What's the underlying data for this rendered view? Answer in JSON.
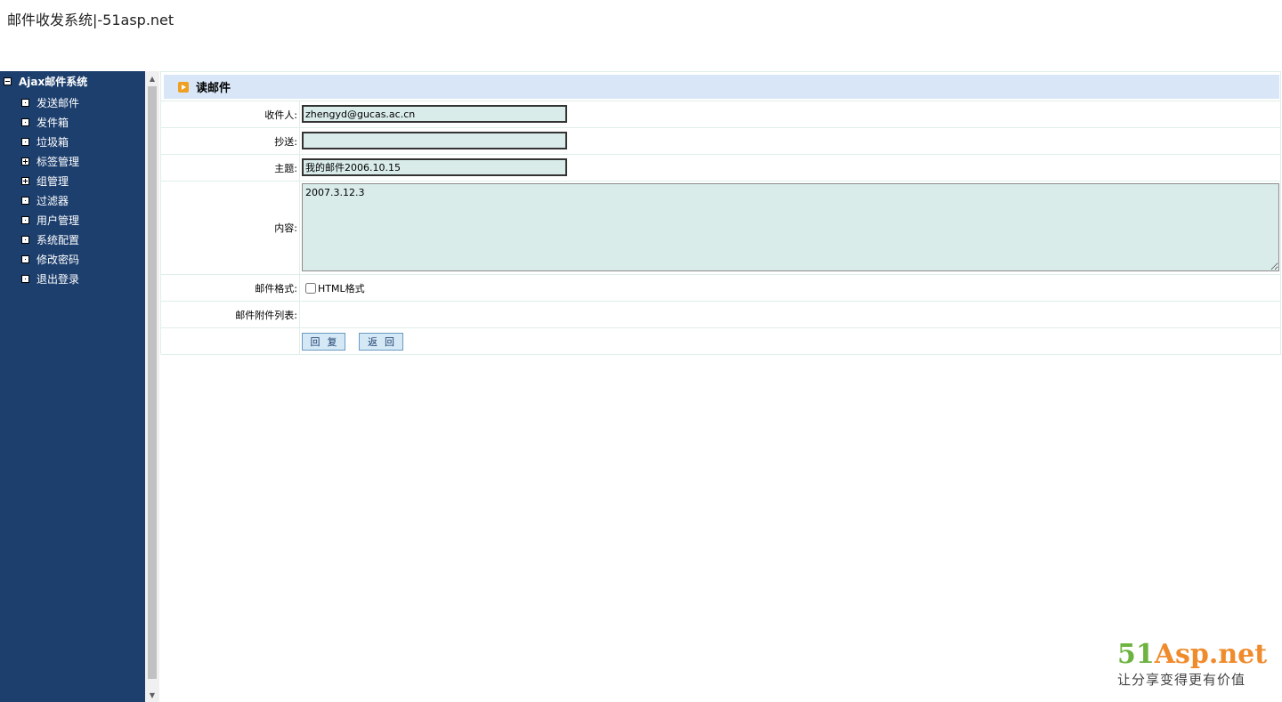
{
  "page": {
    "title": "邮件收发系统|-51asp.net"
  },
  "sidebar": {
    "root_label": "Ajax邮件系统",
    "items": [
      {
        "label": "发送邮件",
        "box": "dot"
      },
      {
        "label": "发件箱",
        "box": "dot"
      },
      {
        "label": "垃圾箱",
        "box": "dot"
      },
      {
        "label": "标签管理",
        "box": "plus"
      },
      {
        "label": "组管理",
        "box": "plus"
      },
      {
        "label": "过滤器",
        "box": "dot"
      },
      {
        "label": "用户管理",
        "box": "dot"
      },
      {
        "label": "系统配置",
        "box": "dot"
      },
      {
        "label": "修改密码",
        "box": "dot"
      },
      {
        "label": "退出登录",
        "box": "dot"
      }
    ]
  },
  "panel": {
    "title": "读邮件",
    "icon": "play-icon"
  },
  "form": {
    "to_label": "收件人:",
    "to_value": "zhengyd@gucas.ac.cn",
    "cc_label": "抄送:",
    "cc_value": "",
    "subject_label": "主题:",
    "subject_value": "我的邮件2006.10.15",
    "content_label": "内容:",
    "content_value": "2007.3.12.3",
    "format_label": "邮件格式:",
    "format_option": "HTML格式",
    "format_checked": false,
    "attachments_label": "邮件附件列表:",
    "reply_button": "回复",
    "back_button": "返回"
  },
  "logo": {
    "num": "51",
    "name": "Asp.net",
    "slogan": "让分享变得更有价值"
  }
}
